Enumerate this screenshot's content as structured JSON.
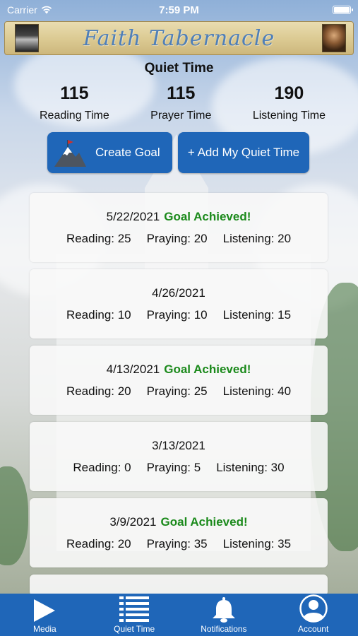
{
  "status_bar": {
    "carrier": "Carrier",
    "time": "7:59 PM"
  },
  "banner": {
    "title": "Faith Tabernacle"
  },
  "page": {
    "heading": "Quiet Time"
  },
  "stats": [
    {
      "value": "115",
      "label": "Reading Time"
    },
    {
      "value": "115",
      "label": "Prayer Time"
    },
    {
      "value": "190",
      "label": "Listening Time"
    }
  ],
  "actions": {
    "create_goal": "Create Goal",
    "add_quiet_time": "+ Add My Quiet Time"
  },
  "entries": [
    {
      "date": "5/22/2021",
      "status": "Goal Achieved!",
      "reading": "Reading: 25",
      "praying": "Praying: 20",
      "listening": "Listening: 20"
    },
    {
      "date": "4/26/2021",
      "status": "",
      "reading": "Reading: 10",
      "praying": "Praying: 10",
      "listening": "Listening: 15"
    },
    {
      "date": "4/13/2021",
      "status": "Goal Achieved!",
      "reading": "Reading: 20",
      "praying": "Praying: 25",
      "listening": "Listening: 40"
    },
    {
      "date": "3/13/2021",
      "status": "",
      "reading": "Reading: 0",
      "praying": "Praying: 5",
      "listening": "Listening: 30"
    },
    {
      "date": "3/9/2021",
      "status": "Goal Achieved!",
      "reading": "Reading: 20",
      "praying": "Praying: 35",
      "listening": "Listening: 35"
    }
  ],
  "tabbar": [
    {
      "label": "Media",
      "icon": "play-icon",
      "active": false
    },
    {
      "label": "Quiet Time",
      "icon": "list-icon",
      "active": true
    },
    {
      "label": "Notifications",
      "icon": "bell-icon",
      "active": false
    },
    {
      "label": "Account",
      "icon": "account-icon",
      "active": false
    }
  ],
  "colors": {
    "accent": "#1f66b8",
    "achieved": "#1b8a1b"
  }
}
